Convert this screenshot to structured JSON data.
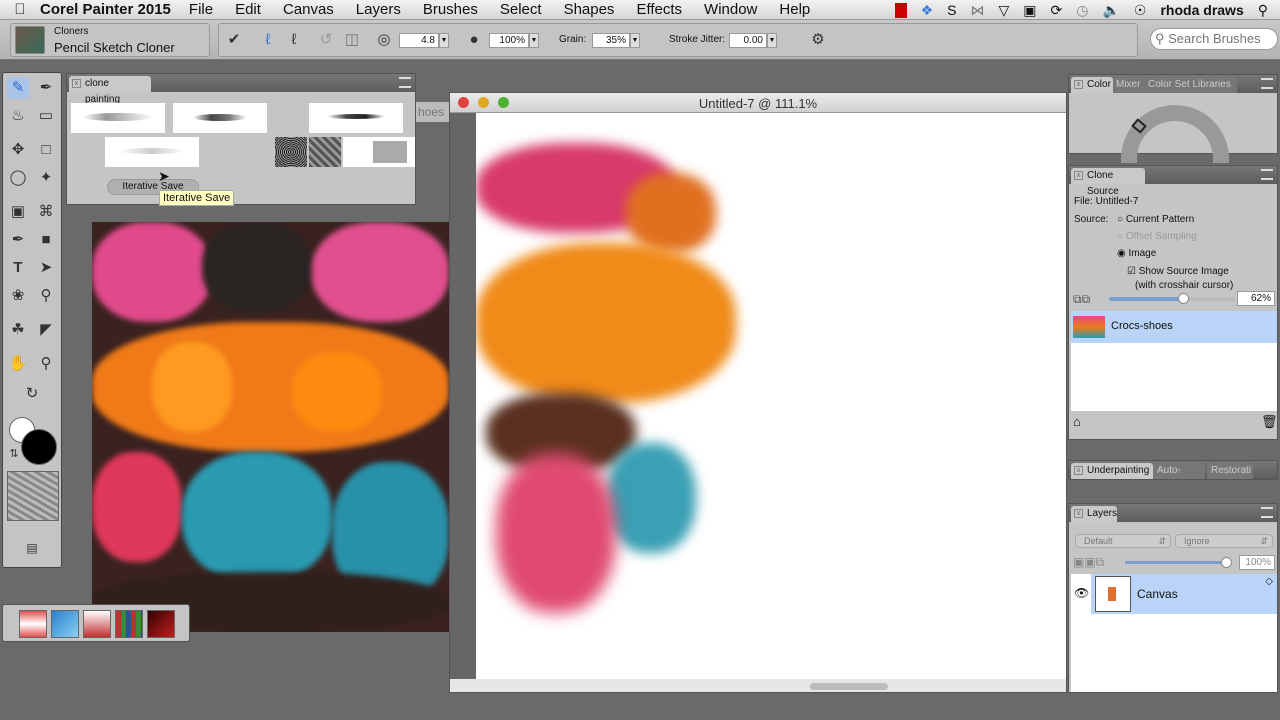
{
  "menubar": {
    "app": "Corel Painter 2015",
    "items": [
      "File",
      "Edit",
      "Canvas",
      "Layers",
      "Brushes",
      "Select",
      "Shapes",
      "Effects",
      "Window",
      "Help"
    ],
    "user": "rhoda draws"
  },
  "propbar": {
    "category": "Cloners",
    "variant": "Pencil Sketch Cloner",
    "size": "4.8",
    "opacity": "100%",
    "grain_label": "Grain:",
    "grain": "35%",
    "jitter_label": "Stroke Jitter:",
    "jitter": "0.00",
    "search_placeholder": "Search Brushes"
  },
  "clone_panel": {
    "tab": "clone painting",
    "button": "Iterative Save",
    "tooltip": "Iterative Save",
    "partial_tab": "hoes"
  },
  "document": {
    "title": "Untitled-7 @ 111.1%"
  },
  "color_panel": {
    "tabs": [
      "Color",
      "Mixer",
      "Color Set Libraries"
    ]
  },
  "clone_source": {
    "tab": "Clone Source",
    "file": "File: Untitled-7",
    "source_label": "Source:",
    "options": [
      {
        "label": "Current Pattern",
        "selected": false,
        "enabled": true
      },
      {
        "label": "Offset Sampling",
        "selected": false,
        "enabled": false
      },
      {
        "label": "Image",
        "selected": true,
        "enabled": true
      }
    ],
    "show_source": "Show Source Image",
    "show_source_note": "(with crosshair cursor)",
    "show_source_checked": true,
    "opacity": "62%",
    "opacity_value": 62,
    "item": "Crocs-shoes"
  },
  "underpainting": {
    "tabs": [
      "Underpainting",
      "Auto-",
      "Restorati"
    ]
  },
  "layers": {
    "tab": "Layers",
    "composite_method": "Default",
    "composite_depth": "Ignore",
    "opacity": "100%",
    "opacity_value": 100,
    "layer": "Canvas"
  },
  "colors": {
    "accent": "#b9d4f7",
    "main_color": "#000000",
    "secondary_color": "#ffffff"
  }
}
